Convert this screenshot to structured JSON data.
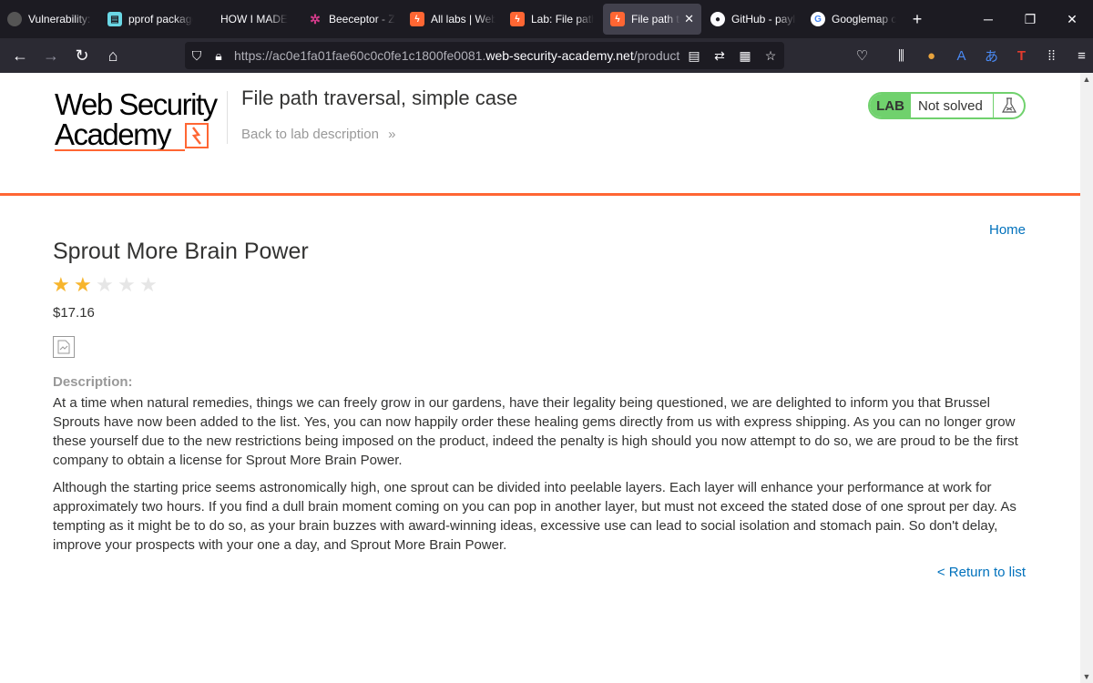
{
  "browser": {
    "tabs": [
      {
        "title": "Vulnerability: S",
        "icon": "ring-icon"
      },
      {
        "title": "pprof package",
        "icon": "go-doc-icon"
      },
      {
        "title": "HOW I MADE",
        "icon": "blank-icon"
      },
      {
        "title": "Beeceptor - Zo",
        "icon": "beeceptor-icon"
      },
      {
        "title": "All labs | Web",
        "icon": "portswigger-icon"
      },
      {
        "title": "Lab: File path",
        "icon": "portswigger-icon"
      },
      {
        "title": "File path tra",
        "icon": "portswigger-icon",
        "active": true
      },
      {
        "title": "GitHub - paylo",
        "icon": "github-icon"
      },
      {
        "title": "Googlemap cu",
        "icon": "google-icon"
      }
    ],
    "new_tab": "+",
    "window_controls": {
      "minimize": "─",
      "restore": "❐",
      "close": "✕"
    },
    "url_prefix": "https://ac0e1fa01fae60c0c0fe1c1800fe0081.",
    "url_domain": "web-security-academy.net",
    "url_suffix": "/product?produ",
    "nav": {
      "back": "←",
      "forward": "→",
      "reload": "↻",
      "home": "⌂"
    }
  },
  "header": {
    "logo_line1": "Web Security",
    "logo_line2": "Academy",
    "lab_title": "File path traversal, simple case",
    "back_link": "Back to lab description",
    "back_chevron": "»",
    "badge_label": "LAB",
    "badge_status": "Not solved"
  },
  "product": {
    "home_link": "Home",
    "name": "Sprout More Brain Power",
    "rating": 2,
    "rating_max": 5,
    "price": "$17.16",
    "description_label": "Description:",
    "description_p1": "At a time when natural remedies, things we can freely grow in our gardens, have their legality being questioned, we are delighted to inform you that Brussel Sprouts have now been added to the list. Yes, you can now happily order these healing gems directly from us with express shipping. As you can no longer grow these yourself due to the new restrictions being imposed on the product, indeed the penalty is high should you now attempt to do so, we are proud to be the first company to obtain a license for Sprout More Brain Power.",
    "description_p2": "Although the starting price seems astronomically high, one sprout can be divided into peelable layers. Each layer will enhance your performance at work for approximately two hours. If you find a dull brain moment coming on you can pop in another layer, but must not exceed the stated dose of one sprout per day. As tempting as it might be to do so, as your brain buzzes with award-winning ideas, excessive use can lead to social isolation and stomach pain. So don't delay, improve your prospects with your one a day, and Sprout More Brain Power.",
    "return_link": "< Return to list"
  },
  "colors": {
    "accent": "#ff6633",
    "lab_green": "#70d16d",
    "link": "#0071bc",
    "star_on": "#f7b52d",
    "star_off": "#e6e6e6"
  }
}
